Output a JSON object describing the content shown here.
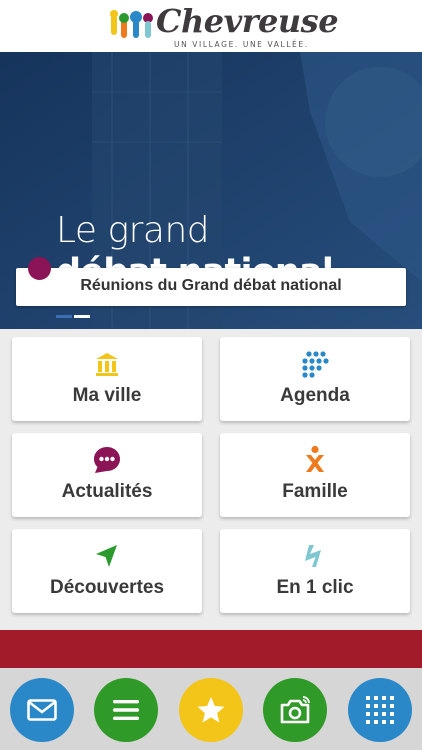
{
  "header": {
    "logo_name": "Chevreuse",
    "logo_tagline": "UN VILLAGE. UNE VALLÉE."
  },
  "hero": {
    "title_line1": "Le grand",
    "title_line2": "débat national",
    "banner_label": "Réunions du Grand débat national"
  },
  "tiles": [
    {
      "label": "Ma ville",
      "icon": "city-hall-icon",
      "color": "#f2c518"
    },
    {
      "label": "Agenda",
      "icon": "dots-grid-icon",
      "color": "#2a88c8"
    },
    {
      "label": "Actualités",
      "icon": "chat-bubble-icon",
      "color": "#8b1457"
    },
    {
      "label": "Famille",
      "icon": "family-icon",
      "color": "#ef7a1c"
    },
    {
      "label": "Découvertes",
      "icon": "navigation-arrow-icon",
      "color": "#2a9a2e"
    },
    {
      "label": "En 1 clic",
      "icon": "lightning-icon",
      "color": "#7fc8d0"
    }
  ],
  "dock": [
    {
      "icon": "mail-icon",
      "color": "#2a88c8"
    },
    {
      "icon": "menu-icon",
      "color": "#2f9a27"
    },
    {
      "icon": "star-icon",
      "color": "#f2c518"
    },
    {
      "icon": "camera-icon",
      "color": "#2f9a27"
    },
    {
      "icon": "grid-icon",
      "color": "#2a88c8"
    }
  ],
  "colors": {
    "hero_bg": "#1c3c66",
    "red_bar": "#a21b2b",
    "dock_bg": "#d6d6d6"
  }
}
